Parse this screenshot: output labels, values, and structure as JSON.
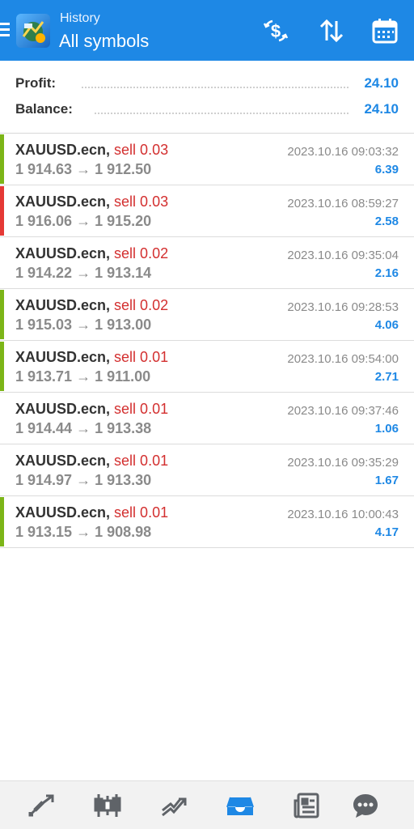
{
  "header": {
    "subtitle": "History",
    "title": "All symbols"
  },
  "summary": {
    "profit_label": "Profit:",
    "profit_value": "24.10",
    "balance_label": "Balance:",
    "balance_value": "24.10"
  },
  "colors": {
    "accent": "#1e88e5",
    "sell": "#d32f2f",
    "bar_green": "#7cb518",
    "bar_red": "#e53935"
  },
  "trades": [
    {
      "symbol": "XAUUSD.ecn,",
      "action": "sell 0.03",
      "prices": "1 914.63 → 1 912.50",
      "time": "2023.10.16 09:03:32",
      "profit": "6.39",
      "bar": "green"
    },
    {
      "symbol": "XAUUSD.ecn,",
      "action": "sell 0.03",
      "prices": "1 916.06 → 1 915.20",
      "time": "2023.10.16 08:59:27",
      "profit": "2.58",
      "bar": "red"
    },
    {
      "symbol": "XAUUSD.ecn,",
      "action": "sell 0.02",
      "prices": "1 914.22 → 1 913.14",
      "time": "2023.10.16 09:35:04",
      "profit": "2.16",
      "bar": "none"
    },
    {
      "symbol": "XAUUSD.ecn,",
      "action": "sell 0.02",
      "prices": "1 915.03 → 1 913.00",
      "time": "2023.10.16 09:28:53",
      "profit": "4.06",
      "bar": "green"
    },
    {
      "symbol": "XAUUSD.ecn,",
      "action": "sell 0.01",
      "prices": "1 913.71 → 1 911.00",
      "time": "2023.10.16 09:54:00",
      "profit": "2.71",
      "bar": "green"
    },
    {
      "symbol": "XAUUSD.ecn,",
      "action": "sell 0.01",
      "prices": "1 914.44 → 1 913.38",
      "time": "2023.10.16 09:37:46",
      "profit": "1.06",
      "bar": "none"
    },
    {
      "symbol": "XAUUSD.ecn,",
      "action": "sell 0.01",
      "prices": "1 914.97 → 1 913.30",
      "time": "2023.10.16 09:35:29",
      "profit": "1.67",
      "bar": "none"
    },
    {
      "symbol": "XAUUSD.ecn,",
      "action": "sell 0.01",
      "prices": "1 913.15 → 1 908.98",
      "time": "2023.10.16 10:00:43",
      "profit": "4.17",
      "bar": "green"
    }
  ],
  "toolbar_icons": [
    "deposit-withdraw-icon",
    "sort-icon",
    "calendar-icon"
  ],
  "bottom_nav": [
    "quotes-icon",
    "chart-icon",
    "trade-icon",
    "history-icon",
    "news-icon",
    "messages-icon"
  ],
  "bottom_nav_active": "history-icon"
}
